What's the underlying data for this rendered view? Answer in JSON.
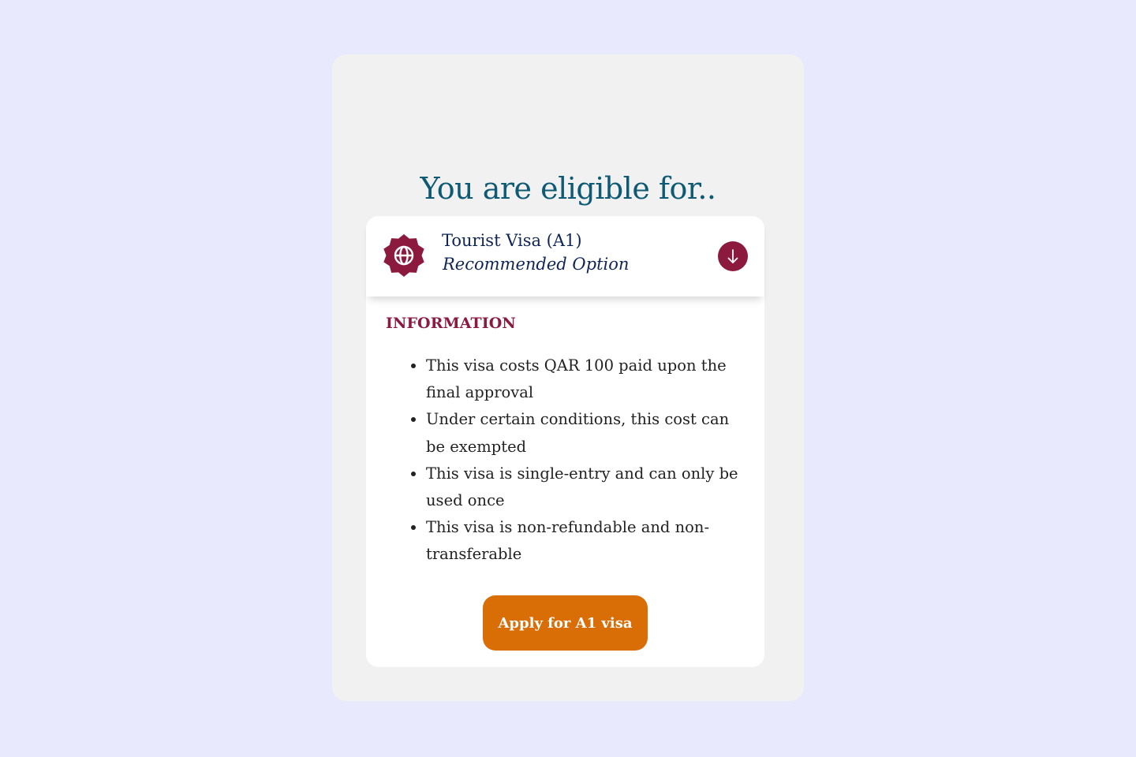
{
  "page": {
    "heading": "You are eligible for.."
  },
  "visa_card": {
    "title": "Tourist Visa (A1)",
    "subtitle": "Recommended Option",
    "badge_icon": "globe-icon",
    "expand_icon": "arrow-down-icon",
    "info": {
      "title": "INFORMATION",
      "items": [
        "This visa costs QAR 100 paid upon the final approval",
        "Under certain conditions, this cost can be exempted",
        "This visa is single-entry and can only be used once",
        "This visa is non-refundable and non-transferable"
      ]
    },
    "apply_label": "Apply for A1 visa"
  },
  "colors": {
    "page_background": "#e8e9fd",
    "panel_background": "#f1f1f1",
    "heading": "#0e5a75",
    "title_navy": "#0f2456",
    "brand_maroon": "#8c1a3f",
    "apply_orange": "#d96d06"
  }
}
